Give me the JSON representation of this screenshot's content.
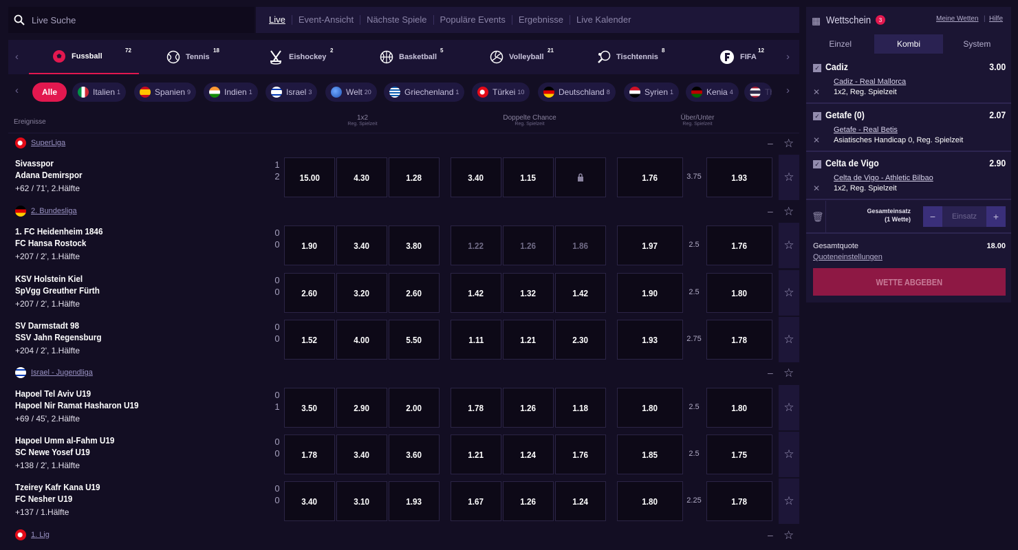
{
  "search": {
    "placeholder": "Live Suche"
  },
  "topnav": [
    "Live",
    "Event-Ansicht",
    "Nächste Spiele",
    "Populäre Events",
    "Ergebnisse",
    "Live Kalender"
  ],
  "sports": [
    {
      "name": "Fussball",
      "count": "72",
      "icon": "soccer-ball-icon"
    },
    {
      "name": "Tennis",
      "count": "18",
      "icon": "tennis-ball-icon"
    },
    {
      "name": "Eishockey",
      "count": "2",
      "icon": "hockey-sticks-icon"
    },
    {
      "name": "Basketball",
      "count": "5",
      "icon": "basketball-icon"
    },
    {
      "name": "Volleyball",
      "count": "21",
      "icon": "volleyball-icon"
    },
    {
      "name": "Tischtennis",
      "count": "8",
      "icon": "table-tennis-icon"
    },
    {
      "name": "FIFA",
      "count": "12",
      "icon": "fifa-icon"
    }
  ],
  "countries": [
    {
      "name": "Alle",
      "count": ""
    },
    {
      "name": "Italien",
      "count": "1"
    },
    {
      "name": "Spanien",
      "count": "9"
    },
    {
      "name": "Indien",
      "count": "1"
    },
    {
      "name": "Israel",
      "count": "3"
    },
    {
      "name": "Welt",
      "count": "20"
    },
    {
      "name": "Griechenland",
      "count": "1"
    },
    {
      "name": "Türkei",
      "count": "10"
    },
    {
      "name": "Deutschland",
      "count": "8"
    },
    {
      "name": "Syrien",
      "count": "1"
    },
    {
      "name": "Kenia",
      "count": "4"
    },
    {
      "name": "Th",
      "count": ""
    }
  ],
  "columns": {
    "events": "Ereignisse",
    "c1": "1x2",
    "c1sub": "Reg. Spielzeit",
    "c2": "Doppelte Chance",
    "c2sub": "Reg. Spielzeit",
    "c3": "Über/Unter",
    "c3sub": "Reg. Spielzeit"
  },
  "leagues": [
    {
      "name": "SuperLiga",
      "events": [
        {
          "home": "Sivasspor",
          "away": "Adana Demirspor",
          "time": "+62 / 71', 2.Hälfte",
          "s1": "1",
          "s2": "2",
          "odds": [
            "15.00",
            "4.30",
            "1.28",
            "3.40",
            "1.15",
            "lock",
            "1.76",
            "3.75",
            "1.93"
          ],
          "dim": false
        }
      ]
    },
    {
      "name": "2. Bundesliga",
      "events": [
        {
          "home": "1. FC Heidenheim 1846",
          "away": "FC Hansa Rostock",
          "time": "+207 / 2', 1.Hälfte",
          "s1": "0",
          "s2": "0",
          "odds": [
            "1.90",
            "3.40",
            "3.80",
            "1.22",
            "1.26",
            "1.86",
            "1.97",
            "2.5",
            "1.76"
          ],
          "dim": true
        },
        {
          "home": "KSV Holstein Kiel",
          "away": "SpVgg Greuther Fürth",
          "time": "+207 / 2', 1.Hälfte",
          "s1": "0",
          "s2": "0",
          "odds": [
            "2.60",
            "3.20",
            "2.60",
            "1.42",
            "1.32",
            "1.42",
            "1.90",
            "2.5",
            "1.80"
          ],
          "dim": false
        },
        {
          "home": "SV Darmstadt 98",
          "away": "SSV Jahn Regensburg",
          "time": "+204 / 2', 1.Hälfte",
          "s1": "0",
          "s2": "0",
          "odds": [
            "1.52",
            "4.00",
            "5.50",
            "1.11",
            "1.21",
            "2.30",
            "1.93",
            "2.75",
            "1.78"
          ],
          "dim": false
        }
      ]
    },
    {
      "name": "Israel - Jugendliga",
      "events": [
        {
          "home": "Hapoel Tel Aviv U19",
          "away": "Hapoel Nir Ramat Hasharon U19",
          "time": "+69 / 45', 2.Hälfte",
          "s1": "0",
          "s2": "1",
          "odds": [
            "3.50",
            "2.90",
            "2.00",
            "1.78",
            "1.26",
            "1.18",
            "1.80",
            "2.5",
            "1.80"
          ],
          "dim": false
        },
        {
          "home": "Hapoel Umm al-Fahm U19",
          "away": "SC Newe Yosef U19",
          "time": "+138 / 2', 1.Hälfte",
          "s1": "0",
          "s2": "0",
          "odds": [
            "1.78",
            "3.40",
            "3.60",
            "1.21",
            "1.24",
            "1.76",
            "1.85",
            "2.5",
            "1.75"
          ],
          "dim": false
        },
        {
          "home": "Tzeirey Kafr Kana U19",
          "away": "FC Nesher U19",
          "time": "+137 / 1.Hälfte",
          "s1": "0",
          "s2": "0",
          "odds": [
            "3.40",
            "3.10",
            "1.93",
            "1.67",
            "1.26",
            "1.24",
            "1.80",
            "2.25",
            "1.78"
          ],
          "dim": false
        }
      ]
    },
    {
      "name": "1. Lig",
      "events": []
    }
  ],
  "betslip": {
    "title": "Wettschein",
    "count": "3",
    "my_bets": "Meine Wetten",
    "help": "Hilfe",
    "tabs": [
      "Einzel",
      "Kombi",
      "System"
    ],
    "bets": [
      {
        "selection": "Cadiz",
        "price": "3.00",
        "match": "Cadiz - Real Mallorca",
        "market": "1x2, Reg. Spielzeit"
      },
      {
        "selection": "Getafe (0)",
        "price": "2.07",
        "match": "Getafe - Real Betis",
        "market": "Asiatisches Handicap 0, Reg. Spielzeit"
      },
      {
        "selection": "Celta de Vigo",
        "price": "2.90",
        "match": "Celta de Vigo - Athletic Bilbao",
        "market": "1x2, Reg. Spielzeit"
      }
    ],
    "stake_label": "Gesamteinsatz",
    "stake_sub": "(1 Wette)",
    "stake_placeholder": "Einsatz",
    "total_label": "Gesamtquote",
    "total_value": "18.00",
    "settings": "Quoteneinstellungen",
    "submit": "WETTE ABGEBEN"
  },
  "colors": {
    "accent": "#e2184f",
    "bg": "#130e23",
    "panel": "#1b1533",
    "submit": "#8e1844"
  }
}
